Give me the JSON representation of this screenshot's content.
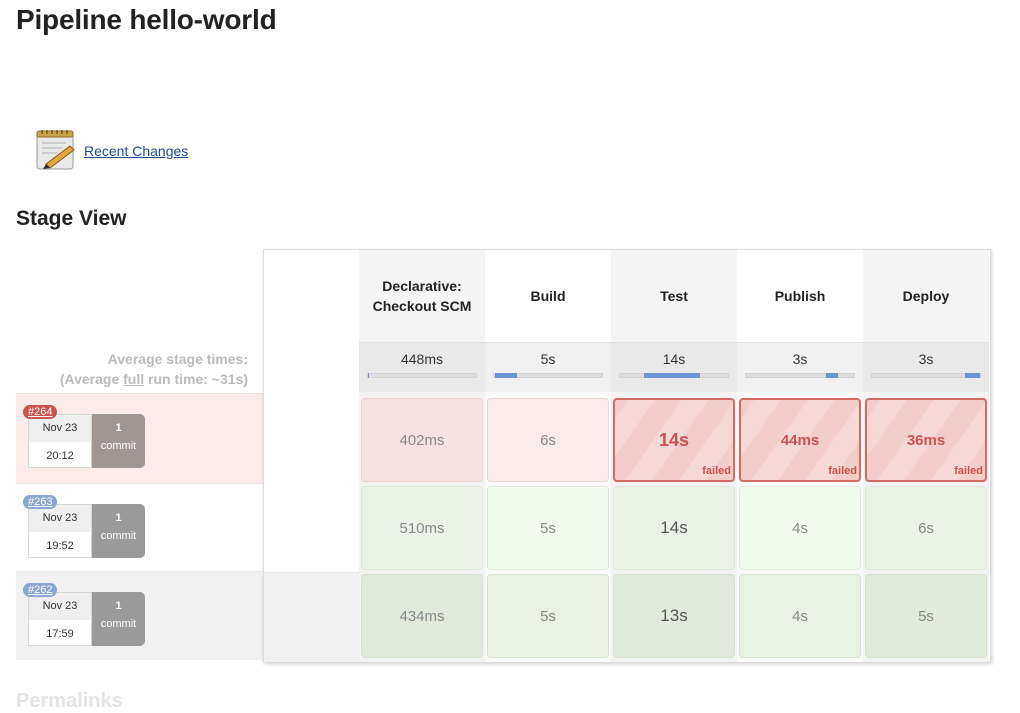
{
  "page": {
    "title": "Pipeline hello-world",
    "recent_changes": {
      "icon": "notepad-pencil-icon",
      "label": "Recent Changes"
    },
    "section_title": "Stage View",
    "next_section_title_partial": "Permalinks"
  },
  "stage_view": {
    "average_label_line1": "Average stage times:",
    "average_label_line2_prefix": "(Average ",
    "average_label_line2_link": "full",
    "average_label_line2_suffix": " run time: ~31s)",
    "stages": [
      {
        "name": "Declarative: Checkout SCM",
        "avg_time": "448ms",
        "avg_bar_start_pct": 0,
        "avg_bar_width_pct": 1
      },
      {
        "name": "Build",
        "avg_time": "5s",
        "avg_bar_start_pct": 1,
        "avg_bar_width_pct": 20
      },
      {
        "name": "Test",
        "avg_time": "14s",
        "avg_bar_start_pct": 22,
        "avg_bar_width_pct": 52
      },
      {
        "name": "Publish",
        "avg_time": "3s",
        "avg_bar_start_pct": 74,
        "avg_bar_width_pct": 11
      },
      {
        "name": "Deploy",
        "avg_time": "3s",
        "avg_bar_start_pct": 86,
        "avg_bar_width_pct": 14
      }
    ],
    "runs": [
      {
        "number": "#264",
        "status": "failed",
        "date": "Nov 23",
        "time": "20:12",
        "commit_count": "1",
        "commit_label": "commit",
        "cells": [
          {
            "time": "402ms",
            "status": "success-in-failed-run",
            "status_label": ""
          },
          {
            "time": "6s",
            "status": "success-in-failed-run",
            "status_label": ""
          },
          {
            "time": "14s",
            "status": "failed",
            "status_label": "failed"
          },
          {
            "time": "44ms",
            "status": "failed",
            "status_label": "failed"
          },
          {
            "time": "36ms",
            "status": "failed",
            "status_label": "failed"
          }
        ]
      },
      {
        "number": "#263",
        "status": "success",
        "date": "Nov 23",
        "time": "19:52",
        "commit_count": "1",
        "commit_label": "commit",
        "cells": [
          {
            "time": "510ms",
            "status": "success",
            "status_label": ""
          },
          {
            "time": "5s",
            "status": "success",
            "status_label": ""
          },
          {
            "time": "14s",
            "status": "success",
            "status_label": ""
          },
          {
            "time": "4s",
            "status": "success",
            "status_label": ""
          },
          {
            "time": "6s",
            "status": "success",
            "status_label": ""
          }
        ]
      },
      {
        "number": "#262",
        "status": "success",
        "date": "Nov 23",
        "time": "17:59",
        "commit_count": "1",
        "commit_label": "commit",
        "cells": [
          {
            "time": "434ms",
            "status": "success",
            "status_label": ""
          },
          {
            "time": "5s",
            "status": "success",
            "status_label": ""
          },
          {
            "time": "13s",
            "status": "success",
            "status_label": ""
          },
          {
            "time": "4s",
            "status": "success",
            "status_label": ""
          },
          {
            "time": "5s",
            "status": "success",
            "status_label": ""
          }
        ]
      }
    ]
  },
  "colors": {
    "failed_accent": "#c9534e",
    "success_badge": "#8ba7cf",
    "avg_bar": "#6e93d0",
    "link": "#204a87"
  }
}
